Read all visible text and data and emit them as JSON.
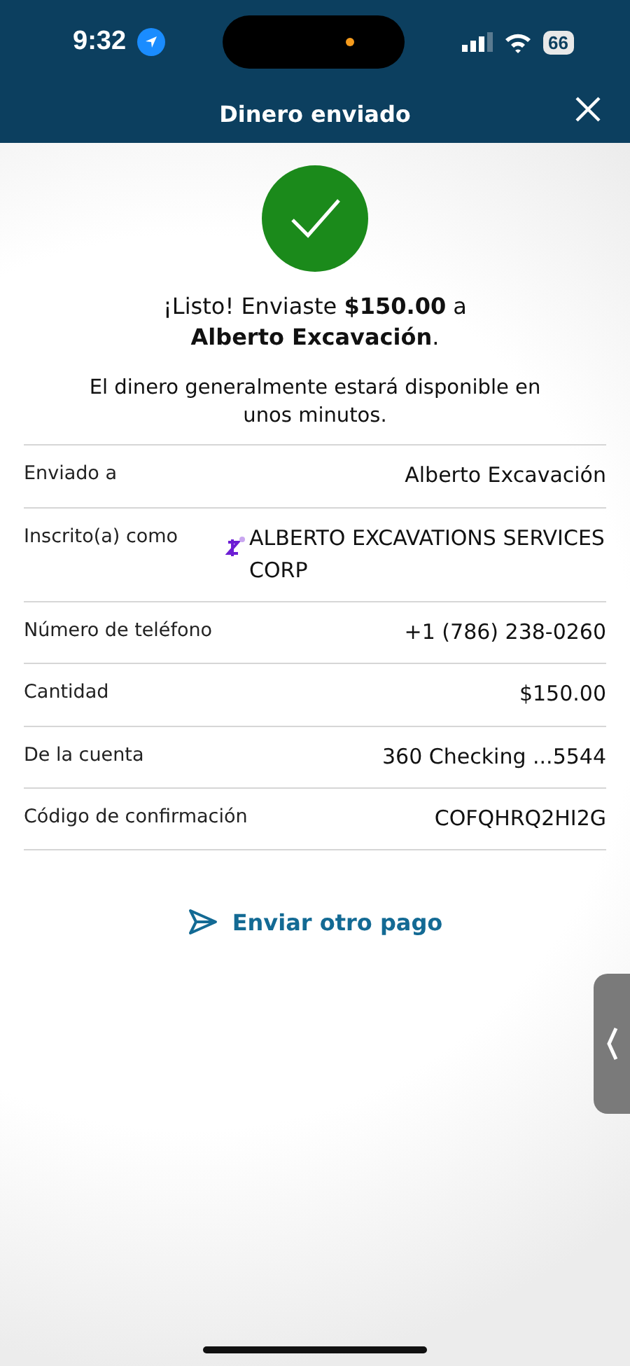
{
  "status_bar": {
    "time": "9:32",
    "battery": "66"
  },
  "header": {
    "title": "Dinero enviado"
  },
  "confirmation": {
    "message": "¡Listo! Enviaste **$150.00** a **Alberto Excavación**.",
    "note": "El dinero generalmente estará disponible en unos minutos."
  },
  "details": [
    {
      "label": "Enviado a",
      "value": "Alberto Excavación",
      "kind": "plain"
    },
    {
      "label": "Inscrito(a) como",
      "value": "ALBERTO EXCAVATIONS SERVICES CORP",
      "kind": "zelle"
    },
    {
      "label": "Número de teléfono",
      "value": "+1 (786) 238-0260",
      "kind": "plain"
    },
    {
      "label": "Cantidad",
      "value": "$150.00",
      "kind": "plain"
    },
    {
      "label": "De la cuenta",
      "value": "360 Checking ...5544",
      "kind": "plain"
    },
    {
      "label": "Código de confirmación",
      "value": "COFQHRQ2HI2G",
      "kind": "plain"
    }
  ],
  "action": {
    "label": "Enviar otro pago"
  }
}
